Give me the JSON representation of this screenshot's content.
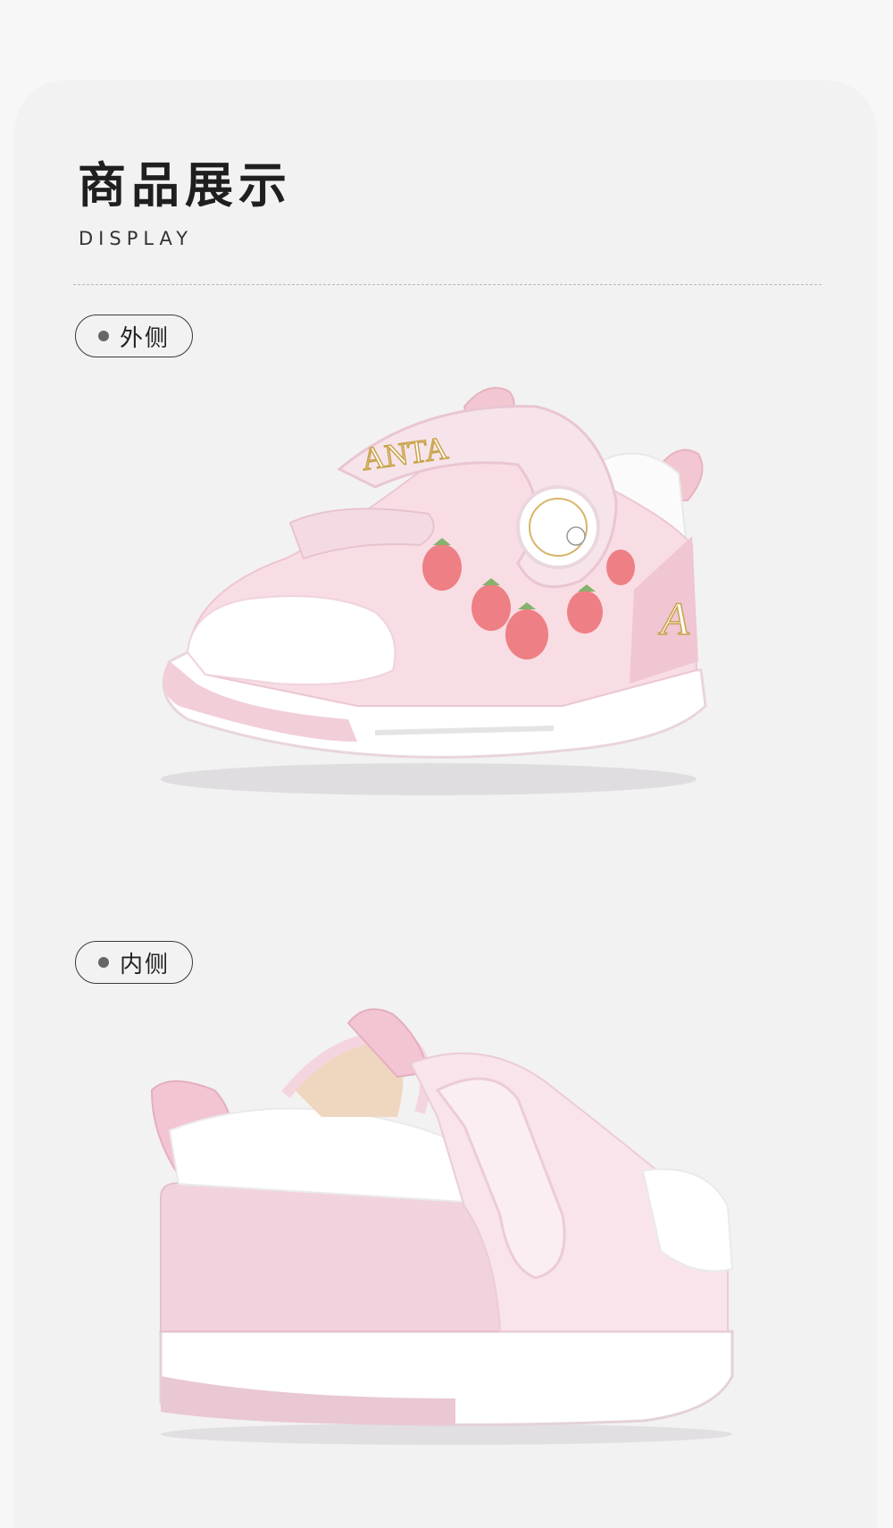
{
  "header": {
    "title_cn": "商品展示",
    "title_en": "DISPLAY"
  },
  "views": [
    {
      "label": "外侧",
      "image": "shoe-outer-side-photo"
    },
    {
      "label": "内侧",
      "image": "shoe-inner-side-photo"
    }
  ],
  "brand_text": "ANTA",
  "colors": {
    "page_bg": "#f7f7f7",
    "card_bg": "#f2f2f2",
    "shoe_pink": "#f5d3dc",
    "shoe_white": "#ffffff",
    "strawberry": "#e8757a"
  }
}
